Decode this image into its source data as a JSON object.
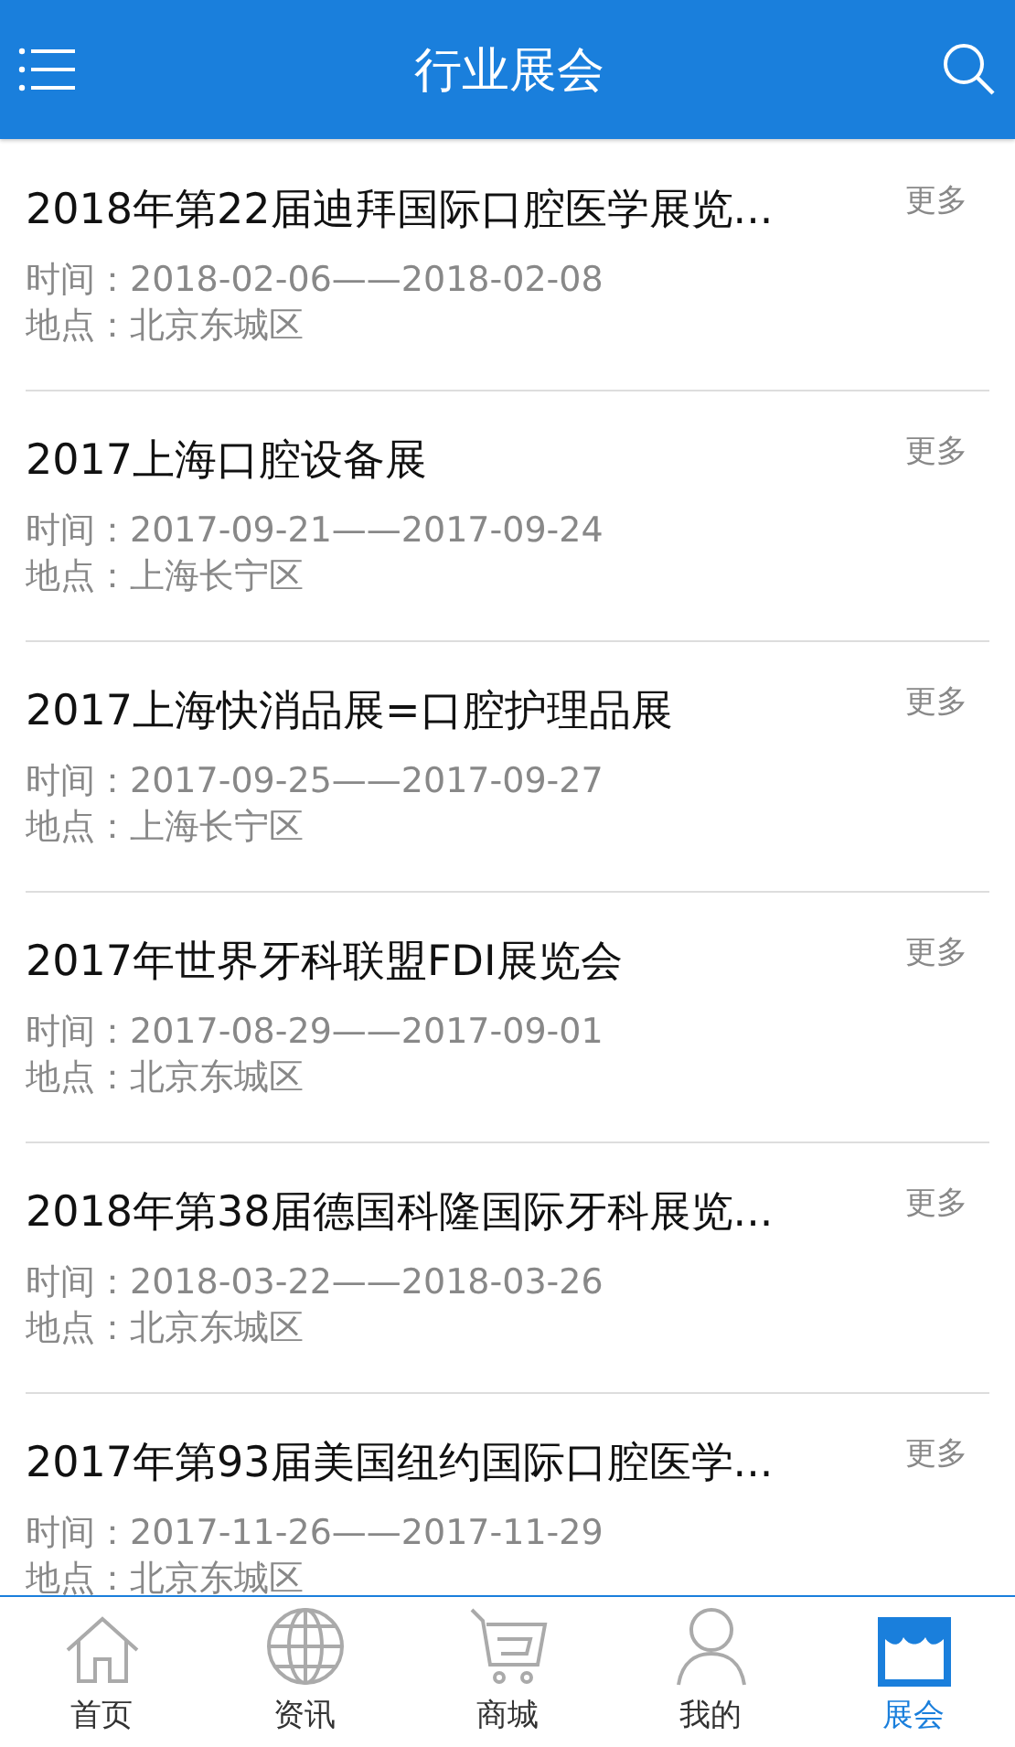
{
  "header": {
    "title": "行业展会"
  },
  "exhibitions": [
    {
      "title": "2018年第22届迪拜国际口腔医学展览...",
      "more": "更多",
      "time": "时间：2018-02-06——2018-02-08",
      "location": "地点：北京东城区"
    },
    {
      "title": "2017上海口腔设备展",
      "more": "更多",
      "time": "时间：2017-09-21——2017-09-24",
      "location": "地点：上海长宁区"
    },
    {
      "title": "2017上海快消品展=口腔护理品展",
      "more": "更多",
      "time": "时间：2017-09-25——2017-09-27",
      "location": "地点：上海长宁区"
    },
    {
      "title": "2017年世界牙科联盟FDI展览会",
      "more": "更多",
      "time": "时间：2017-08-29——2017-09-01",
      "location": "地点：北京东城区"
    },
    {
      "title": "2018年第38届德国科隆国际牙科展览...",
      "more": "更多",
      "time": "时间：2018-03-22——2018-03-26",
      "location": "地点：北京东城区"
    },
    {
      "title": "2017年第93届美国纽约国际口腔医学...",
      "more": "更多",
      "time": "时间：2017-11-26——2017-11-29",
      "location": "地点：北京东城区"
    }
  ],
  "tab_bar": [
    {
      "label": "首页",
      "kind": "home",
      "selected": false
    },
    {
      "label": "资讯",
      "kind": "globe",
      "selected": false
    },
    {
      "label": "商城",
      "kind": "cart",
      "selected": false
    },
    {
      "label": "我的",
      "kind": "person",
      "selected": false
    },
    {
      "label": "展会",
      "kind": "store",
      "selected": true
    }
  ]
}
